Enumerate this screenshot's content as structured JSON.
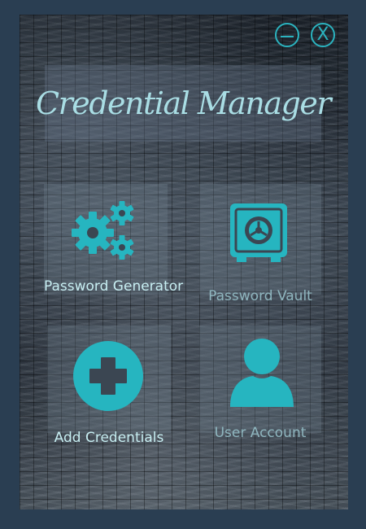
{
  "window": {
    "title": "Credential Manager",
    "minimize_label": "–",
    "close_label": "X"
  },
  "tiles": [
    {
      "label": "Password Generator",
      "icon": "gears-icon"
    },
    {
      "label": "Password Vault",
      "icon": "safe-icon"
    },
    {
      "label": "Add Credentials",
      "icon": "plus-circle-icon"
    },
    {
      "label": "User Account",
      "icon": "user-icon"
    }
  ],
  "colors": {
    "accent": "#26b5c0",
    "text_bright": "#c7eef2",
    "title": "#a9dde4",
    "frame": "#2a3e52"
  }
}
